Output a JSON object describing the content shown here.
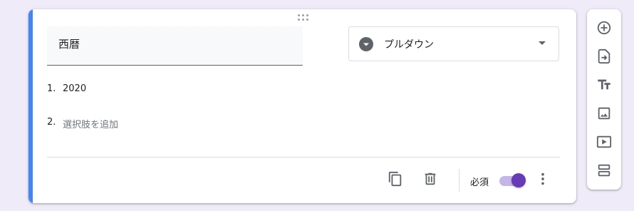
{
  "question": {
    "title_value": "西暦",
    "type_label": "プルダウン",
    "options": [
      {
        "number": "1.",
        "text": "2020"
      },
      {
        "number": "2.",
        "text": "選択肢を追加"
      }
    ],
    "required_label": "必須",
    "required_on": true
  },
  "colors": {
    "accent": "#4285f4",
    "toggle_thumb": "#673ab7",
    "toggle_track": "#c6b5ea",
    "page_bg": "#f0ebf8"
  },
  "icons": {
    "drag": "drag-handle-icon",
    "type": "dropdown-circle-icon",
    "duplicate": "duplicate-icon",
    "delete": "trash-icon",
    "more": "more-vert-icon",
    "add_question": "add-circle-icon",
    "import": "import-questions-icon",
    "title": "title-text-icon",
    "image": "image-icon",
    "video": "video-icon",
    "section": "section-icon"
  }
}
